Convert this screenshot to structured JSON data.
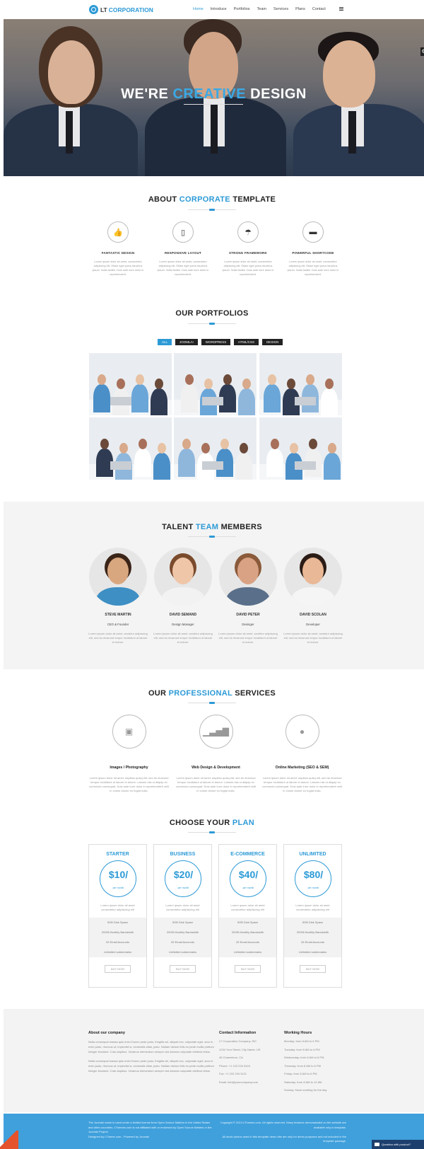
{
  "header": {
    "logo_lt": "LT",
    "logo_corp": "CORPORATION",
    "nav": [
      {
        "label": "Home",
        "active": true
      },
      {
        "label": "Introduce",
        "active": false
      },
      {
        "label": "Portfolios",
        "active": false
      },
      {
        "label": "Team",
        "active": false
      },
      {
        "label": "Services",
        "active": false
      },
      {
        "label": "Plans",
        "active": false
      },
      {
        "label": "Contact",
        "active": false
      }
    ]
  },
  "hero": {
    "title_pre": "WE'RE",
    "title_accent": "CREATIVE",
    "title_post": "DESIGN"
  },
  "about": {
    "title_pre": "ABOUT",
    "title_accent": "CORPORATE",
    "title_post": "TEMPLATE",
    "features": [
      {
        "icon": "thumbs-up-icon",
        "glyph": "👍",
        "title": "FANTASTIC DESIGN",
        "text": "Lorem ipsum dolor sit amet, consectetur adipiscing elit. Etiam eget purus faucibus ipsum. Nulla facilisi. Duis aute irure dolor in reprehenderit."
      },
      {
        "icon": "tablet-icon",
        "glyph": "▯",
        "title": "RESPONSIVE LAYOUT",
        "text": "Lorem ipsum dolor sit amet, consectetur adipiscing elit. Etiam eget purus faucibus ipsum. Nulla facilisi. Duis aute irure dolor in reprehenderit."
      },
      {
        "icon": "umbrella-icon",
        "glyph": "☂",
        "title": "STRONG FRAMEWORK",
        "text": "Lorem ipsum dolor sit amet, consectetur adipiscing elit. Etiam eget purus faucibus ipsum. Nulla facilisi. Duis aute irure dolor in reprehenderit."
      },
      {
        "icon": "folder-icon",
        "glyph": "▬",
        "title": "POWERFUL SHORTCODE",
        "text": "Lorem ipsum dolor sit amet, consectetur adipiscing elit. Etiam eget purus faucibus ipsum. Nulla facilisi. Duis aute irure dolor in reprehenderit."
      }
    ]
  },
  "portfolio": {
    "title_pre": "OUR",
    "title_accent": "",
    "title_post": "PORTFOLIOS",
    "filters": [
      {
        "label": "ALL",
        "active": true
      },
      {
        "label": "JOOMLA!",
        "active": false
      },
      {
        "label": "WORDPRESS",
        "active": false
      },
      {
        "label": "HTML/CSS",
        "active": false
      },
      {
        "label": "DESIGN",
        "active": false
      }
    ]
  },
  "team": {
    "title_pre": "TALENT",
    "title_accent": "TEAM",
    "title_post": "MEMBERS",
    "members": [
      {
        "name": "STEVE MARTIN",
        "role": "CEO & Founder",
        "text": "Lorem ipsum dolor sit amet, sectetur adipiscing elit, sed do eiusmod empor incididunt ut labore et dolore.",
        "skin": "#d8a77f",
        "hair": "#3b2418",
        "shirt": "#3d8fc4"
      },
      {
        "name": "DAVID SEMAND",
        "role": "Design Manager",
        "text": "Lorem ipsum dolor sit amet, sectetur adipiscing elit, sed do eiusmod empor incididunt ut labore et dolore.",
        "skin": "#efc6a8",
        "hair": "#7a4a2c",
        "shirt": "#f2f2f2"
      },
      {
        "name": "DAVID PETER",
        "role": "Desinger",
        "text": "Lorem ipsum dolor sit amet, sectetur adipiscing elit, sed do eiusmod empor incididunt ut labore et dolore.",
        "skin": "#d9a284",
        "hair": "#8a5a3a",
        "shirt": "#5a6f8a"
      },
      {
        "name": "DAVID SCOLAN",
        "role": "Developer",
        "text": "Lorem ipsum dolor sit amet, sectetur adipiscing elit, sed do eiusmod empor incididunt ut labore et dolore.",
        "skin": "#e9b896",
        "hair": "#2b1c16",
        "shirt": "#f5f5f5"
      }
    ]
  },
  "services": {
    "title_pre": "OUR",
    "title_accent": "PROFESSIONAL",
    "title_post": "SERVICES",
    "items": [
      {
        "icon": "image-icon",
        "glyph": "▣",
        "title": "Images / Photography",
        "text": "Lorem ipsum dolor sit amet, dapibus quisq elit, sed do eiusmod tempor incididunt ut labore et dolore. Laboris nisi ut aliquip ex commodo consequat. Duis aute irure dolor in reprehenderit velit in vulum dolore eu fugiat nulla."
      },
      {
        "icon": "signal-bars-icon",
        "glyph": "▁▃▅▇",
        "title": "Web Design & Development",
        "text": "Lorem ipsum dolor sit amet, dapibus quisq elit, sed do eiusmod tempor incididunt ut labore et dolore. Laboris nisi ut aliquip ex commodo consequat. Duis aute irure dolor in reprehenderit velit in vulum dolore eu fugiat nulla."
      },
      {
        "icon": "chat-bubble-icon",
        "glyph": "●",
        "title": "Online Marketing (SEO & SEM)",
        "text": "Lorem ipsum dolor sit amet, dapibus quisq elit, sed do eiusmod tempor incididunt ut labore et dolore. Laboris nisi ut aliquip ex commodo consequat. Duis aute irure dolor in reprehenderit velit in vulum dolore eu fugiat nulla."
      }
    ]
  },
  "plans": {
    "title_pre": "CHOOSE YOUR",
    "title_accent": "PLAN",
    "title_post": "",
    "items": [
      {
        "name": "STARTER",
        "price": "$10/",
        "per": "per month",
        "desc": "Lorem ipsum dolor sit amet consectetur adipisicing elit",
        "features": [
          "5GB Disk Space",
          "20GB Monthly Bandwidth",
          "25 Email Accounts",
          "Unlimited subdomains"
        ],
        "button": "BUY NOW"
      },
      {
        "name": "BUSINESS",
        "price": "$20/",
        "per": "per month",
        "desc": "Lorem ipsum dolor sit amet consectetur adipisicing elit",
        "features": [
          "5GB Disk Space",
          "20GB Monthly Bandwidth",
          "25 Email Accounts",
          "Unlimited subdomains"
        ],
        "button": "BUY NOW"
      },
      {
        "name": "E-COMMERCE",
        "price": "$40/",
        "per": "per month",
        "desc": "Lorem ipsum dolor sit amet consectetur adipisicing elit",
        "features": [
          "5GB Disk Space",
          "20GB Monthly Bandwidth",
          "25 Email Accounts",
          "Unlimited subdomains"
        ],
        "button": "BUY NOW"
      },
      {
        "name": "UNLIMITED",
        "price": "$80/",
        "per": "per month",
        "desc": "Lorem ipsum dolor sit amet consectetur adipisicing elit",
        "features": [
          "5GB Disk Space",
          "20GB Monthly Bandwidth",
          "25 Email Accounts",
          "Unlimited subdomains"
        ],
        "button": "BUY NOW"
      }
    ]
  },
  "footer": {
    "about_head": "About our company",
    "about_p1": "Nulla consequat massa quis enim Donec pede justo, fringilla vel, aliquet nec, vulputate eget, arcu in enim justo, rhoncus ut, imperdiet a, venenatis vitae, justo. Nullam dictum felis eu pede mollis pretium Integer tincidunt. Cras dapibus. Vivamus elementum semper nisi Aenean vulputate eleifend tellus.",
    "about_p2": "Nulla consequat massa quis enim Donec pede justo, fringilla vel, aliquet nec, vulputate eget, arcu in enim justo, rhoncus ut, imperdiet a, venenatis vitae, justo. Nullam dictum felis eu pede mollis pretium Integer tincidunt. Cras dapibus. Vivamus elementum semper nisi Aenean vulputate eleifend tellus.",
    "contact_head": "Contact Information",
    "contact_lines": [
      "LT Corporation Company JSC",
      "1234 Your Street, City Name, US",
      "45 Chameleon, CA",
      "Phone: +1 123 234 3424",
      "Fax: +1 102 234 3121",
      "Email: info@yourcompany.com"
    ],
    "hours_head": "Working Hours",
    "hours_lines": [
      "Monday: from 8 AM to 6 PM",
      "Tuesday: from 8 AM to 6 PM",
      "Wednesday: from 8 AM to 6 PM",
      "Thursday: from 8 AM to 6 PM",
      "Friday: from 8 AM to 6 PM",
      "Saturday: from 8 AM to 12 AM",
      "Sunday: None-working for the day"
    ]
  },
  "bottom": {
    "left": "The Joomla! name is used under a limited license from Open Source Matters in the United States and other countries. LThemes.com is not affiliated with or endorsed by Open Source Matters or the Joomla! Project.",
    "credit": "Designed by LTheme.com - Powered by Joomla!",
    "right": "Copyright © 2013 LThemes.com. All rights reserved. Many features demonstrated on the website are available only in template.",
    "right2": "All stock photos used in this template demo site are only for demo purposes and not included in the template package."
  },
  "chat": {
    "label": "Question with product?"
  },
  "colors": {
    "accent": "#2d9ad6",
    "footer_bottom": "#3fa0dc"
  }
}
